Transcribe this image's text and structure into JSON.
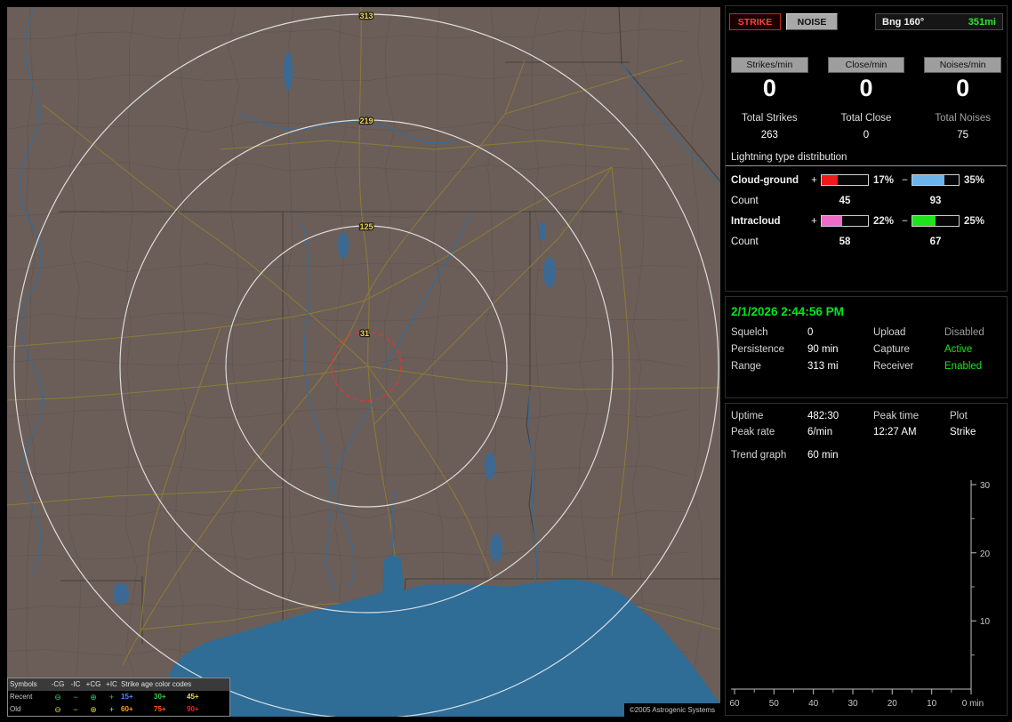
{
  "colors": {
    "datetime_green": "#00e61e",
    "bearing_green": "#2ce62c"
  },
  "map": {
    "rings": [
      {
        "label": "313"
      },
      {
        "label": "219"
      },
      {
        "label": "125"
      },
      {
        "label": "31"
      }
    ],
    "copyright": "©2005 Astrogenic Systems",
    "legend": {
      "title_symbols": "Symbols",
      "symbol_cols": [
        "-CG",
        "-IC",
        "+CG",
        "+IC"
      ],
      "symbols": [
        "⊖",
        "−",
        "⊕",
        "+"
      ],
      "title_age": "Strike age color codes",
      "rows": [
        {
          "label": "Recent",
          "icon_color": "#3cc86c",
          "ages": [
            {
              "text": "15+",
              "color": "#4b8cff"
            },
            {
              "text": "30+",
              "color": "#2ed052"
            },
            {
              "text": "45+",
              "color": "#e8e23a"
            }
          ]
        },
        {
          "label": "Old",
          "icon_color": "#ddd23a",
          "ages": [
            {
              "text": "60+",
              "color": "#ffa028"
            },
            {
              "text": "75+",
              "color": "#ff6020"
            },
            {
              "text": "90+",
              "color": "#ff2020"
            }
          ]
        }
      ]
    }
  },
  "panel": {
    "strike_button": "STRIKE",
    "noise_button": "NOISE",
    "bearing": {
      "label": "Bng 160°",
      "distance": "351mi"
    },
    "rates": [
      {
        "label": "Strikes/min",
        "value": "0",
        "total_label": "Total Strikes",
        "total_value": "263",
        "total_label_color": "#dcdcdc"
      },
      {
        "label": "Close/min",
        "value": "0",
        "total_label": "Total Close",
        "total_value": "0",
        "total_label_color": "#dcdcdc"
      },
      {
        "label": "Noises/min",
        "value": "0",
        "total_label": "Total Noises",
        "total_value": "75",
        "total_label_color": "#a2a2a2"
      }
    ],
    "distribution": {
      "title": "Lightning type distribution",
      "plus": "+",
      "minus": "−",
      "rows": [
        {
          "label": "Cloud-ground",
          "count_label": "Count",
          "pos_pct": 17,
          "pos_pct_text": "17%",
          "pos_color": "#f01818",
          "pos_count": "45",
          "neg_pct": 35,
          "neg_pct_text": "35%",
          "neg_color": "#6cb4ec",
          "neg_count": "93"
        },
        {
          "label": "Intracloud",
          "count_label": "Count",
          "pos_pct": 22,
          "pos_pct_text": "22%",
          "pos_color": "#ec6cc8",
          "pos_count": "58",
          "neg_pct": 25,
          "neg_pct_text": "25%",
          "neg_color": "#1ee41e",
          "neg_count": "67"
        }
      ]
    },
    "status": {
      "datetime": "2/1/2026 2:44:56 PM",
      "rows": [
        {
          "l1": "Squelch",
          "v1": "0",
          "l2": "Upload",
          "v2": "Disabled",
          "v2_color": "#9c9c9c"
        },
        {
          "l1": "Persistence",
          "v1": "90 min",
          "l2": "Capture",
          "v2": "Active",
          "v2_color": "#1ce41c"
        },
        {
          "l1": "Range",
          "v1": "313 mi",
          "l2": "Receiver",
          "v2": "Enabled",
          "v2_color": "#1ce41c"
        }
      ]
    },
    "session": {
      "uptime_label": "Uptime",
      "uptime_value": "482:30",
      "peak_time_label": "Peak time",
      "plot_label": "Plot",
      "peak_rate_label": "Peak rate",
      "peak_rate_value": "6/min",
      "peak_time_value": "12:27 AM",
      "plot_value": "Strike",
      "trend_label": "Trend graph",
      "trend_value": "60 min"
    },
    "trend_chart": {
      "y_ticks": [
        "30",
        "20",
        "10"
      ],
      "x_ticks": [
        "60",
        "50",
        "40",
        "30",
        "20",
        "10"
      ],
      "x_end_label": "0 min"
    }
  }
}
